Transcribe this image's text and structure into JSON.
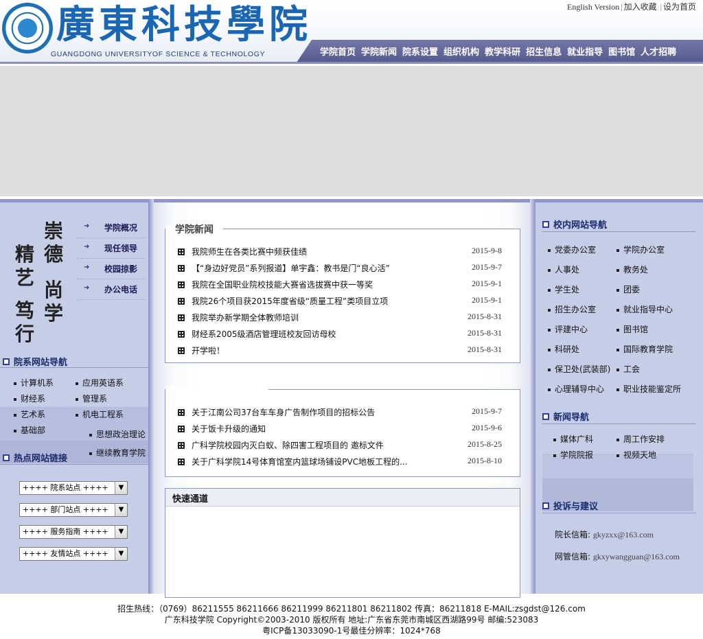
{
  "header": {
    "logo_title": "廣東科技學院",
    "logo_subtitle": "GUANGDONG UNIVERSITYOF SCIENCE & TECHNOLOGY",
    "top_links": [
      "English Version",
      "加入收藏",
      "设为首页"
    ],
    "nav": [
      "学院首页",
      "学院新闻",
      "院系设置",
      "组织机构",
      "教学科研",
      "招生信息",
      "就业指导",
      "图书馆",
      "人才招聘"
    ]
  },
  "left": {
    "slogan": [
      "崇",
      "德",
      "尚",
      "学",
      "精",
      "艺",
      "笃",
      "行"
    ],
    "quick_links": [
      "学院概况",
      "现任领导",
      "校园掠影",
      "办公电话"
    ],
    "dept_nav_title": "院系网站导航",
    "dept_links": [
      "计算机系",
      "应用英语系",
      "财经系",
      "管理系",
      "艺术系",
      "机电工程系",
      "基础部",
      "思想政治理论",
      "继续教育学院"
    ],
    "hot_links_title": "热点网站链接",
    "selects": [
      "++++ 院系站点 ++++",
      "++++ 部门站点 ++++",
      "++++ 服务指南 ++++",
      "++++ 友情站点 ++++"
    ]
  },
  "center": {
    "news_title": "学院新闻",
    "news": [
      {
        "title": "我院师生在各类比赛中频获佳绩",
        "date": "2015-9-8"
      },
      {
        "title": "【“身边好党员”系列报道】单宇鑫：教书是门“良心活”",
        "date": "2015-9-7"
      },
      {
        "title": "我院在全国职业院校技能大赛省选拔赛中获一等奖",
        "date": "2015-9-1"
      },
      {
        "title": "我院26个项目获2015年度省级“质量工程”类项目立项",
        "date": "2015-9-1"
      },
      {
        "title": "我院举办新学期全体教师培训",
        "date": "2015-8-31"
      },
      {
        "title": "财经系2005级酒店管理班校友回访母校",
        "date": "2015-8-31"
      },
      {
        "title": "开学啦！",
        "date": "2015-8-31"
      }
    ],
    "notices": [
      {
        "title": "关于江南公司37台车车身广告制作项目的招标公告",
        "date": "2015-9-7"
      },
      {
        "title": "关于饭卡升级的通知",
        "date": "2015-9-6"
      },
      {
        "title": "广科学院校园内灭白蚁、除四害工程项目的 邀标文件",
        "date": "2015-8-25"
      },
      {
        "title": "关于广科学院14号体育馆室内篮球场铺设PVC地板工程的...",
        "date": "2015-8-10"
      }
    ],
    "fast_title": "快速通道"
  },
  "right": {
    "campus_nav_title": "校内网站导航",
    "campus_links": [
      "党委办公室",
      "学院办公室",
      "人事处",
      "教务处",
      "学生处",
      "团委",
      "招生办公室",
      "就业指导中心",
      "评建中心",
      "图书馆",
      "科研处",
      "国际教育学院",
      "保卫处(武装部)",
      "工会",
      "心理辅导中心",
      "职业技能鉴定所"
    ],
    "news_nav_title": "新闻导航",
    "news_links": [
      "媒体广科",
      "周工作安排",
      "学院院报",
      "视频天地"
    ],
    "complaint_title": "投诉与建议",
    "mail": [
      {
        "label": "院长信箱:",
        "value": "gkyzxx@163.com"
      },
      {
        "label": "网管信箱:",
        "value": "gkxywangguan@163.com"
      }
    ]
  },
  "footer": {
    "line1": "招生热线：（0769）86211555 86211666 86211999 86211801 86211802 传真：86211818 E-MAIL:zsgdst@126.com",
    "line2": "广东科技学院  Copyright©2003-2010 版权所有  地址:广东省东莞市南城区西湖路99号  邮编:523083",
    "line3": "粤ICP备13033090-1号最佳分辨率：1024*768"
  },
  "colors": {
    "brand_blue": "#1a66b2",
    "nav_purple": "#5b5f93",
    "sidebar_bg": "#c6cde6"
  }
}
